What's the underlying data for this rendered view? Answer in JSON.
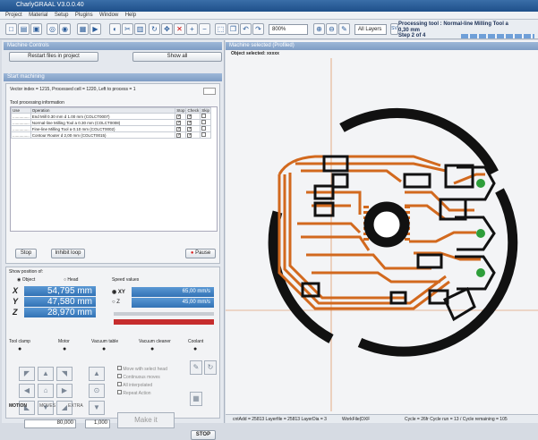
{
  "window": {
    "title": "CharlyGRAAL V3.0.0.40"
  },
  "menu": [
    "Project",
    "Material",
    "Setup",
    "Plugins",
    "Window",
    "Help"
  ],
  "toolbar": {
    "zoom": "800%",
    "layers": "All Layers",
    "sv": "SV"
  },
  "processing": {
    "line1": "Processing tool : Normal-line Milling Tool a",
    "line2": "0,30 mm",
    "line3": "Step 2 of 4"
  },
  "machine_controls": {
    "title": "Machine Controls",
    "restart": "Restart files in project",
    "show_all": "Show all"
  },
  "start_machining": {
    "title": "Start machining",
    "info": "Vector index = 1215, Processed cell = 1220, Left to process = 1",
    "group": "Tool processing information",
    "cols": [
      "Use",
      "Operation",
      "Stop",
      "Check",
      "Skip"
    ],
    "rows": [
      {
        "use": "...............",
        "op": "End Mill 0.30 mm d 1.00 mm (COLCT0007)"
      },
      {
        "use": "...............",
        "op": "Normal-line Milling Tool a 0.30 mm (COLCT0008)"
      },
      {
        "use": "...............",
        "op": "Fine-line Milling Tool a 0.10 mm (COLCT0002)"
      },
      {
        "use": "...............",
        "op": "Contour Router d 2,00 mm (COLCT0015)"
      }
    ],
    "stop": "Stop",
    "inhibit": "Inhibit loop",
    "pause": "Pause"
  },
  "position": {
    "title": "Show position of:",
    "object": "Object",
    "head": "Head",
    "x": "54,795 mm",
    "y": "47,580 mm",
    "z": "28,970 mm",
    "speed_title": "Speed values",
    "xy_label": "XY",
    "xy": "65,00 mm/s",
    "z_label": "Z",
    "z_speed": "45,00 mm/s"
  },
  "devices": [
    "Tool clamp",
    "Motor",
    "Vacuum table",
    "Vacuum cleaner",
    "Coolant"
  ],
  "options": [
    "Move with select head",
    "Continuous moves",
    "All interpolated",
    "Repeat Action"
  ],
  "step_xy": "80,000",
  "step_z": "1,000",
  "make_it": "Make it",
  "stop_btn": "STOP",
  "tabs": [
    "MOTION",
    "MOVES",
    "EXTRA"
  ],
  "canvas": {
    "title": "Machine selected (Profiled)",
    "object": "Object selected: xxxxx"
  },
  "statusbar": {
    "s1": "cntAdd = 25813 Layerfile = 25813 LayerDia = 3",
    "s2": "WorkFile(DXF",
    "s3": "Cycle = 26fr Cycle run = 13 / Cycle remaining = 105"
  },
  "colors": {
    "trace": "#d2691e",
    "pad_black": "#111111",
    "pad_green": "#2e9e3a",
    "accent": "#3a78c0"
  }
}
